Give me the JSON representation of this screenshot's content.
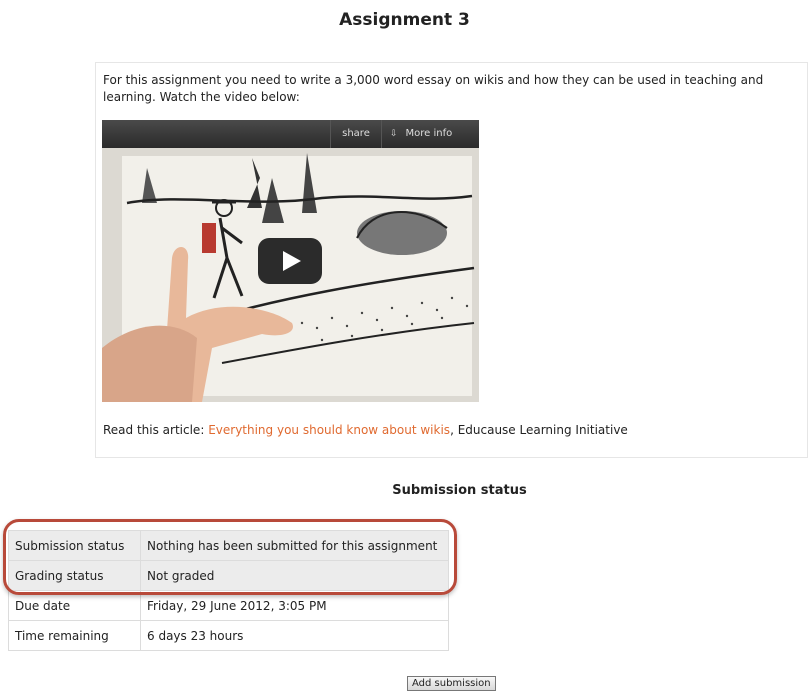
{
  "assignment": {
    "title": "Assignment 3",
    "intro": "For this assignment you need to write a 3,000 word essay on wikis and how they can be used in teaching and learning. Watch the video below:"
  },
  "video": {
    "share_label": "share",
    "more_info_label": "More info",
    "more_info_icon": "double-chevron-down-icon",
    "play_icon": "play-icon"
  },
  "article": {
    "prefix": "Read this article: ",
    "link_text": "Everything you should know about wikis",
    "suffix": ", Educause Learning Initiative",
    "link_color": "#e06a30"
  },
  "submission": {
    "heading": "Submission status",
    "rows": [
      {
        "label": "Submission status",
        "value": "Nothing has been submitted for this assignment"
      },
      {
        "label": "Grading status",
        "value": "Not graded"
      },
      {
        "label": "Due date",
        "value": "Friday, 29 June 2012, 3:05 PM"
      },
      {
        "label": "Time remaining",
        "value": "6 days 23 hours"
      }
    ],
    "highlight_color": "#b84a3a",
    "add_button_label": "Add submission"
  }
}
